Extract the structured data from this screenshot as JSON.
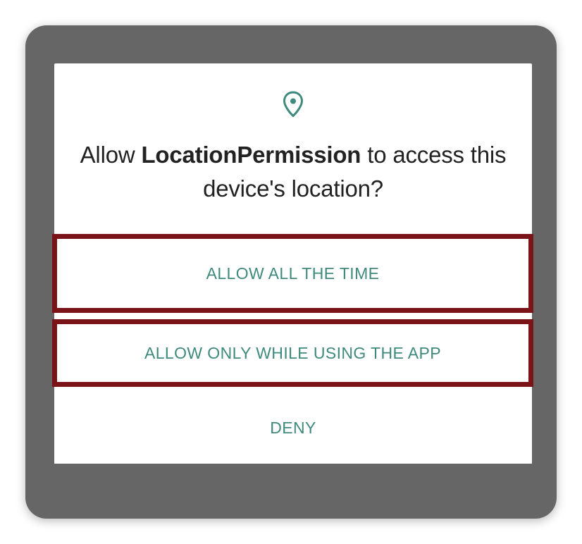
{
  "dialog": {
    "icon": "location-pin-icon",
    "title_prefix": "Allow ",
    "app_name": "LocationPermission",
    "title_suffix": " to access this device's location?",
    "accent_color": "#3f8a7d",
    "highlight_color": "#7a1419",
    "actions": [
      {
        "label": "ALLOW ALL THE TIME"
      },
      {
        "label": "ALLOW ONLY WHILE USING THE APP"
      },
      {
        "label": "DENY"
      }
    ]
  }
}
